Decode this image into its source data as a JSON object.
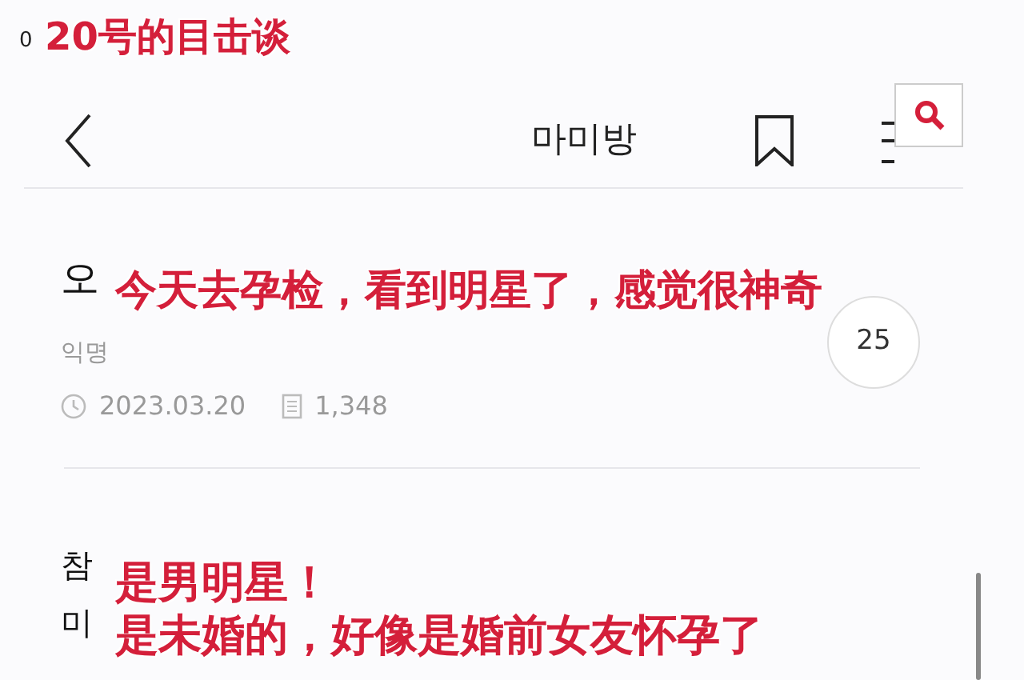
{
  "status_bar": {
    "text": "0"
  },
  "caption": "20号的目击谈",
  "nav": {
    "title": "마미방"
  },
  "posts": [
    {
      "title_lines": [
        "오"
      ],
      "author": "익명",
      "date": "2023.03.20",
      "views": "1,348",
      "comments": "25",
      "captions": [
        "今天去孕检，看到明星了，感觉很神奇"
      ]
    },
    {
      "title_lines": [
        "참",
        "미"
      ],
      "captions": [
        "是男明星！",
        "是未婚的，好像是婚前女友怀孕了"
      ]
    }
  ]
}
